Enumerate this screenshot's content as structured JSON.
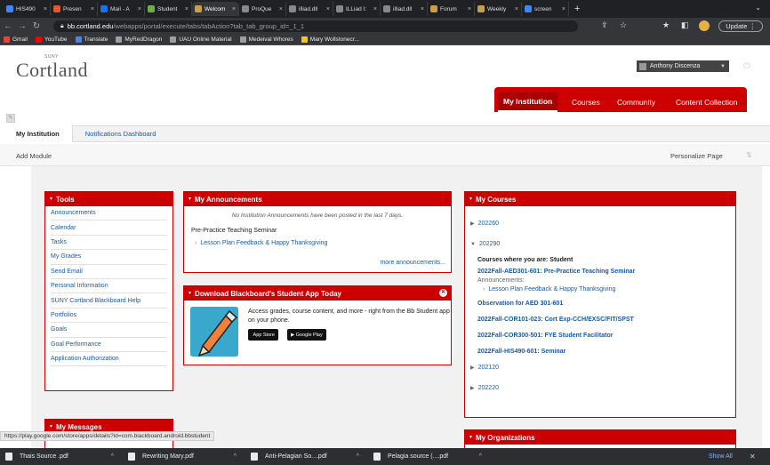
{
  "browser": {
    "tabs": [
      {
        "label": "HIS490",
        "color": "#4285f4"
      },
      {
        "label": "Presen",
        "color": "#e8572a"
      },
      {
        "label": "Mail - A",
        "color": "#1a73e8"
      },
      {
        "label": "Student",
        "color": "#6ab04c"
      },
      {
        "label": "Welcom",
        "color": "#c8a04a",
        "active": true
      },
      {
        "label": "ProQue",
        "color": "#888888"
      },
      {
        "label": "illiad.dll",
        "color": "#888888"
      },
      {
        "label": "ILLiad I:",
        "color": "#888888"
      },
      {
        "label": "illiad.dll",
        "color": "#888888"
      },
      {
        "label": "Forum",
        "color": "#c8a04a"
      },
      {
        "label": "Weekly",
        "color": "#c8a04a"
      },
      {
        "label": "screen",
        "color": "#4285f4"
      }
    ],
    "new_tab": "+",
    "tab_menu": "⌄",
    "url_host": "bb.cortland.edu",
    "url_path": "/webapps/portal/execute/tabs/tabAction?tab_tab_group_id=_1_1",
    "update_label": "Update",
    "bookmarks": [
      {
        "label": "Gmail",
        "color": "#ea4335"
      },
      {
        "label": "YouTube",
        "color": "#ff0000"
      },
      {
        "label": "Translate",
        "color": "#4285f4"
      },
      {
        "label": "MyRedDragon",
        "color": "#9aa0a6"
      },
      {
        "label": "UAU Online Material",
        "color": "#9aa0a6"
      },
      {
        "label": "Medeival Whores",
        "color": "#9aa0a6"
      },
      {
        "label": "Mary Wollstonecr...",
        "color": "#f5c518"
      }
    ]
  },
  "site": {
    "logo_suny": "SUNY",
    "logo": "Cortland",
    "user": "Anthony Discenza",
    "nav_tabs": [
      "My Institution",
      "Courses",
      "Community",
      "Content Collection"
    ],
    "subnav": [
      "My Institution",
      "Notifications Dashboard"
    ],
    "add_module": "Add Module",
    "personalize": "Personalize Page"
  },
  "tools": {
    "title": "Tools",
    "items": [
      "Announcements",
      "Calendar",
      "Tasks",
      "My Grades",
      "Send Email",
      "Personal Information",
      "SUNY Cortland Blackboard Help",
      "Portfolios",
      "Goals",
      "Goal Performance",
      "Application Authorization"
    ]
  },
  "messages": {
    "title": "My Messages"
  },
  "announcements": {
    "title": "My Announcements",
    "none": "No Institution Announcements have been posted in the last 7 days.",
    "course": "Pre-Practice Teaching Seminar",
    "link": "Lesson Plan Feedback & Happy Thanksgiving",
    "more": "more announcements..."
  },
  "app": {
    "title": "Download Blackboard's Student App Today",
    "text": "Access grades, course content, and more - right from the Bb Student app on your phone.",
    "appstore": "App Store",
    "googleplay": "Google Play"
  },
  "courses": {
    "title": "My Courses",
    "term1": "202260",
    "term2": "202290",
    "where": "Courses where you are: Student",
    "c1": "2022Fall-AED301-601: Pre-Practice Teaching Seminar",
    "ann_label": "Announcements:",
    "ann_link": "Lesson Plan Feedback & Happy Thanksgiving",
    "c2": "Observation for AED 301-601",
    "c3": "2022Fall-COR101-023: Cort Exp-CCH/EXSC/FIT/SPST",
    "c4": "2022Fall-COR300-501: FYE Student Facilitator",
    "c5": "2022Fall-HIS490-601: Seminar",
    "term3": "202120",
    "term4": "202220"
  },
  "organizations": {
    "title": "My Organizations"
  },
  "status_url": "https://play.google.com/store/apps/details?id=com.blackboard.android.bbstudent",
  "downloads": {
    "items": [
      "Thais Source .pdf",
      "Rewriting Mary.pdf",
      "Anti-Pelagian So....pdf",
      "Pelagia source (....pdf"
    ],
    "show_all": "Show All",
    "close": "✕"
  }
}
